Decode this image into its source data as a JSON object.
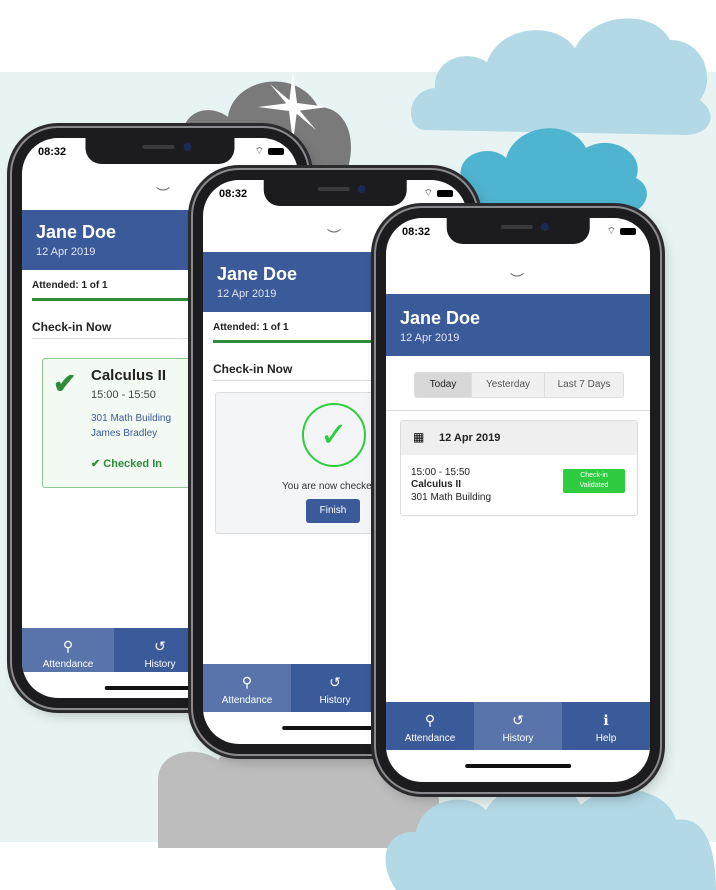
{
  "status_bar": {
    "time": "08:32",
    "signal": "…",
    "wifi": "wifi-icon"
  },
  "user": {
    "name": "Jane Doe",
    "date": "12 Apr 2019"
  },
  "tabs": [
    {
      "label": "Attendance",
      "icon": "map-pin-icon"
    },
    {
      "label": "History",
      "icon": "history-icon"
    },
    {
      "label": "Help",
      "icon": "info-icon"
    }
  ],
  "phone1": {
    "attended": "Attended: 1 of 1",
    "section_title": "Check-in Now",
    "class": {
      "name": "Calculus II",
      "time": "15:00 - 15:50",
      "location": "301 Math Building",
      "instructor": "James Bradley",
      "status": "Checked In"
    }
  },
  "phone2": {
    "attended": "Attended: 1 of 1",
    "section_title": "Check-in Now",
    "message": "You are now checked",
    "finish_label": "Finish"
  },
  "phone3": {
    "segments": [
      "Today",
      "Yesterday",
      "Last 7 Days"
    ],
    "selected_segment": "Today",
    "day_header": "12 Apr 2019",
    "entry": {
      "time": "15:00 - 15:50",
      "name": "Calculus II",
      "location": "301 Math Building",
      "badge_line1": "Check-in",
      "badge_line2": "Validated"
    }
  },
  "colors": {
    "header_blue": "#3b5a99",
    "tab_active": "#5874ab",
    "success_green": "#2e8b3a",
    "badge_green": "#2ecc40",
    "light_bg": "#e8f4f3",
    "cloud_light": "#b3d9e6",
    "cloud_teal": "#4fb4cf",
    "cloud_gray": "#7a7a7a"
  }
}
